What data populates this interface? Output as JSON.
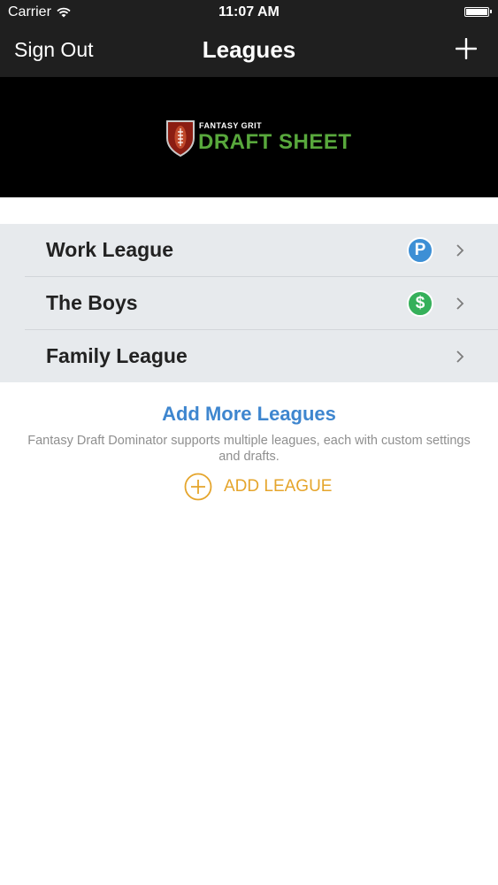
{
  "status_bar": {
    "carrier": "Carrier",
    "time": "11:07 AM"
  },
  "nav": {
    "left_button": "Sign Out",
    "title": "Leagues",
    "right_icon": "plus-icon"
  },
  "banner": {
    "logo_small": "FANTASY GRIT",
    "logo_big": "DRAFT SHEET"
  },
  "leagues": [
    {
      "name": "Work League",
      "badge": "P",
      "badge_color": "#3d8fd5"
    },
    {
      "name": "The Boys",
      "badge": "$",
      "badge_color": "#35b05a"
    },
    {
      "name": "Family League",
      "badge": "",
      "badge_color": ""
    }
  ],
  "add_more": {
    "title": "Add More Leagues",
    "description": "Fantasy Draft Dominator supports multiple leagues, each with custom settings and drafts.",
    "button_label": "ADD LEAGUE"
  },
  "colors": {
    "accent_blue": "#3e86cf",
    "accent_orange": "#e5a52c",
    "logo_green": "#58a83c"
  }
}
